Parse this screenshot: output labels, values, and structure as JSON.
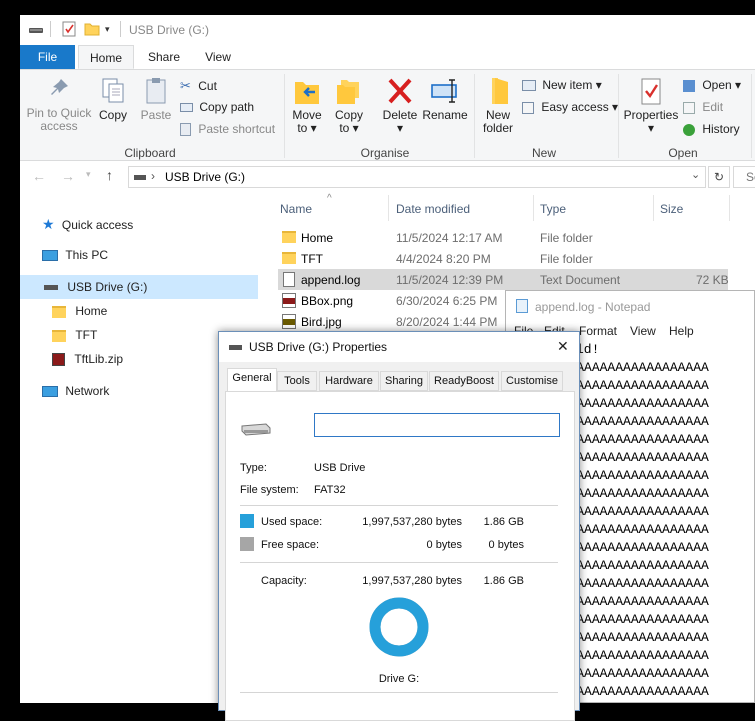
{
  "explorer": {
    "window_title": "USB Drive (G:)",
    "tabs": [
      "File",
      "Home",
      "Share",
      "View"
    ],
    "ribbon": {
      "clipboard": {
        "pin_label": [
          "Pin to Quick",
          "access"
        ],
        "copy_label": "Copy",
        "paste_label": "Paste",
        "cut_label": "Cut",
        "copy_path_label": "Copy path",
        "paste_shortcut_label": "Paste shortcut",
        "group_label": "Clipboard"
      },
      "organise": {
        "move_label": [
          "Move",
          "to"
        ],
        "copy_to_label": [
          "Copy",
          "to"
        ],
        "delete_label": "Delete",
        "rename_label": "Rename",
        "group_label": "Organise"
      },
      "new": {
        "new_folder_label": [
          "New",
          "folder"
        ],
        "new_item_label": "New item",
        "easy_access_label": "Easy access",
        "group_label": "New"
      },
      "open": {
        "properties_label": "Properties",
        "open_label": "Open",
        "edit_label": "Edit",
        "history_label": "History",
        "group_label": "Open"
      }
    },
    "address": {
      "path": "USB Drive (G:)",
      "search_placeholder": "Se"
    },
    "nav": {
      "quick_access": "Quick access",
      "this_pc": "This PC",
      "usb_drive": "USB Drive (G:)",
      "home": "Home",
      "tft": "TFT",
      "tftlib": "TftLib.zip",
      "network": "Network"
    },
    "columns": {
      "name": "Name",
      "date": "Date modified",
      "type": "Type",
      "size": "Size"
    },
    "files": [
      {
        "name": "Home",
        "date": "11/5/2024 12:17 AM",
        "type": "File folder",
        "size": "",
        "icon": "folder-icon"
      },
      {
        "name": "TFT",
        "date": "4/4/2024 8:20 PM",
        "type": "File folder",
        "size": "",
        "icon": "folder-icon"
      },
      {
        "name": "append.log",
        "date": "11/5/2024 12:39 PM",
        "type": "Text Document",
        "size": "72 KB",
        "icon": "text-file-icon"
      },
      {
        "name": "BBox.png",
        "date": "6/30/2024 6:25 PM",
        "type": "",
        "size": "",
        "icon": "png-file-icon"
      },
      {
        "name": "Bird.jpg",
        "date": "8/20/2024 1:44 PM",
        "type": "",
        "size": "",
        "icon": "jpg-file-icon"
      }
    ]
  },
  "notepad": {
    "title": "append.log - Notepad",
    "menu": [
      "File",
      "Edit",
      "Format",
      "View",
      "Help"
    ],
    "first_line": "ld!",
    "line": "AAAAAAAAAAAAAAAAAAAAAAAAAA"
  },
  "properties": {
    "title": "USB Drive (G:) Properties",
    "close_glyph": "✕",
    "tabs": [
      "General",
      "Tools",
      "Hardware",
      "Sharing",
      "ReadyBoost",
      "Customise"
    ],
    "label_input_value": "",
    "type_label": "Type:",
    "type_value": "USB Drive",
    "fs_label": "File system:",
    "fs_value": "FAT32",
    "used_label": "Used space:",
    "used_bytes": "1,997,537,280 bytes",
    "used_short": "1.86 GB",
    "free_label": "Free space:",
    "free_bytes": "0 bytes",
    "free_short": "0 bytes",
    "capacity_label": "Capacity:",
    "capacity_bytes": "1,997,537,280 bytes",
    "capacity_short": "1.86 GB",
    "drive_label": "Drive G:",
    "used_fraction": 1.0,
    "colors": {
      "used": "#26a0da",
      "free": "#a6a6a6"
    }
  }
}
